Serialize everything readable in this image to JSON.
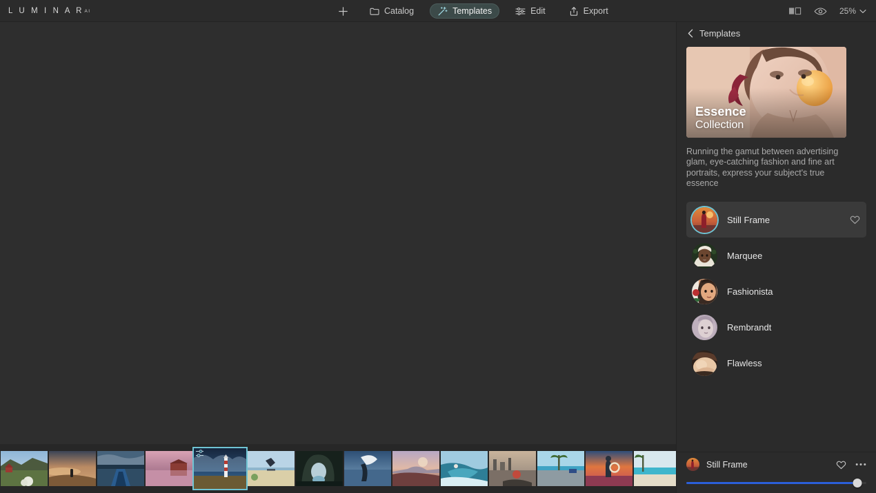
{
  "app": {
    "logo": "L U M I N A R",
    "logo_sup": "AI"
  },
  "toolbar": {
    "add_label": "",
    "items": [
      {
        "label": "Catalog",
        "icon": "folder-icon",
        "active": false
      },
      {
        "label": "Templates",
        "icon": "magic-wand-icon",
        "active": true
      },
      {
        "label": "Edit",
        "icon": "sliders-icon",
        "active": false
      },
      {
        "label": "Export",
        "icon": "share-upload-icon",
        "active": false
      }
    ],
    "compare_icon": "compare-split-icon",
    "preview_icon": "eye-icon",
    "zoom_value": "25%",
    "zoom_chevron": "chevron-down-icon"
  },
  "panel": {
    "back_icon": "chevron-left-icon",
    "title": "Templates",
    "hero": {
      "title": "Essence",
      "subtitle": "Collection",
      "alt": "woman-blowing-bubblegum-portrait"
    },
    "description": "Running the gamut between advertising glam, eye-catching fashion and fine art portraits, express your subject's true essence",
    "templates": [
      {
        "name": "Still Frame",
        "selected": true,
        "favorite_icon": "heart-icon",
        "avatar": "woman-red-dress-sunset"
      },
      {
        "name": "Marquee",
        "selected": false,
        "avatar": "woman-white-headwrap"
      },
      {
        "name": "Fashionista",
        "selected": false,
        "avatar": "woman-red-light-face"
      },
      {
        "name": "Rembrandt",
        "selected": false,
        "avatar": "woman-pale-portrait"
      },
      {
        "name": "Flawless",
        "selected": false,
        "avatar": "woman-skin-closeup"
      }
    ]
  },
  "footer": {
    "name": "Still Frame",
    "avatar": "woman-red-dress-sunset",
    "favorite_icon": "heart-icon",
    "more_icon": "ellipsis-icon",
    "slider_value": 95
  },
  "filmstrip": {
    "items": [
      {
        "alt": "red-cabin-green-hillside",
        "selected": false
      },
      {
        "alt": "person-on-dune-at-sunset",
        "selected": false
      },
      {
        "alt": "blue-boat-bow-on-lake",
        "selected": false
      },
      {
        "alt": "pink-sunset-houses-reflection",
        "selected": false
      },
      {
        "alt": "lighthouse-under-storm-clouds",
        "selected": true
      },
      {
        "alt": "skateboarder-jumping-beach",
        "selected": false
      },
      {
        "alt": "ice-cave-glacier",
        "selected": false
      },
      {
        "alt": "person-with-flowing-cloth-on-water",
        "selected": false
      },
      {
        "alt": "pastel-coastal-cliffs",
        "selected": false
      },
      {
        "alt": "surfer-riding-wave",
        "selected": false
      },
      {
        "alt": "person-in-canoe-city-skyline",
        "selected": false
      },
      {
        "alt": "palm-tree-beach-road",
        "selected": false
      },
      {
        "alt": "woman-with-float-ring-sunset",
        "selected": false
      },
      {
        "alt": "palm-tree-turquoise-sea",
        "selected": false
      }
    ]
  },
  "colors": {
    "accent_teal": "#6fc4d4",
    "slider_blue": "#2b5fd9",
    "active_pill": "#3c4a49",
    "canvas_bg": "#2e2e2e",
    "panel_bg": "#2b2b2b"
  }
}
